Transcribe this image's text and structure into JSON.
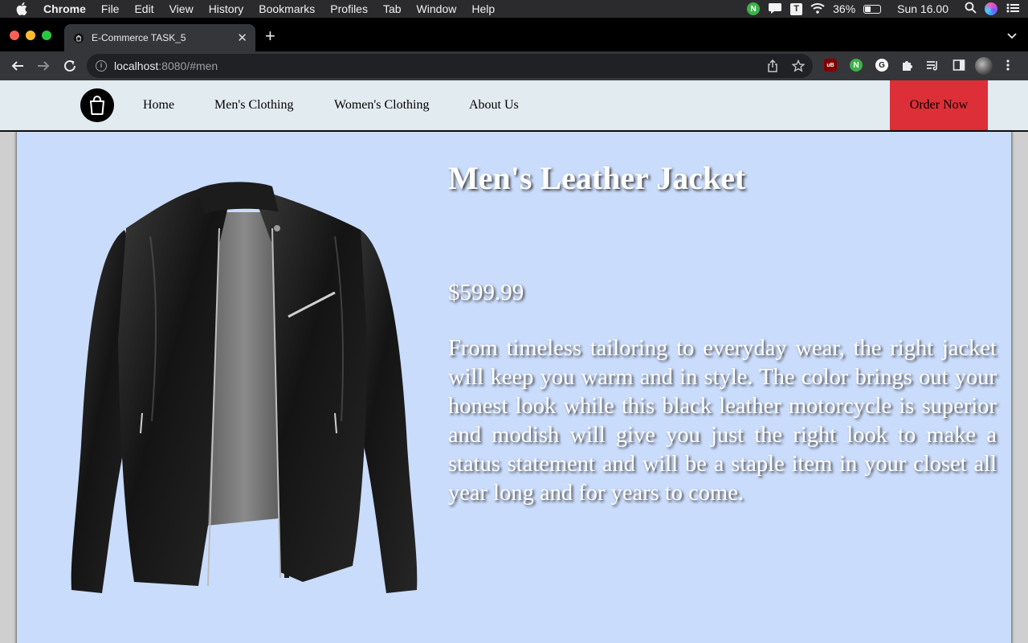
{
  "menubar": {
    "app_name": "Chrome",
    "menus": [
      "File",
      "Edit",
      "View",
      "History",
      "Bookmarks",
      "Profiles",
      "Tab",
      "Window",
      "Help"
    ],
    "battery_percent": "36%",
    "battery_level": 0.36,
    "clock": "Sun 16.00",
    "status_icons": [
      "n-extension-icon",
      "notification-icon",
      "t-icon",
      "wifi-icon",
      "battery-icon",
      "search-icon",
      "siri-icon",
      "control-center-icon"
    ]
  },
  "browser": {
    "tab_title": "E-Commerce TASK_5",
    "url_host": "localhost",
    "url_rest": ":8080/#men",
    "extension_icons": [
      "ublock-icon",
      "n-extension-icon",
      "grammarly-icon",
      "puzzle-extensions-icon",
      "reading-list-icon",
      "side-panel-icon",
      "profile-avatar",
      "more-menu-icon"
    ]
  },
  "site": {
    "nav": {
      "logo_icon": "shopping-bag-icon",
      "links": [
        "Home",
        "Men's Clothing",
        "Women's Clothing",
        "About Us"
      ],
      "order_button": "Order Now",
      "order_color": "#dc2f38"
    },
    "product": {
      "image_alt": "black leather jacket",
      "name": "Men's Leather Jacket",
      "price": "$599.99",
      "description": "From timeless tailoring to everyday wear, the right jacket will keep you warm and in style. The color brings out your honest look while this black leather motorcycle is superior and modish will give you just the right look to make a status statement and will be a staple item in your closet all year long and for years to come."
    },
    "colors": {
      "nav_background": "#e2ebf0",
      "product_background": "#cadcfc"
    }
  }
}
